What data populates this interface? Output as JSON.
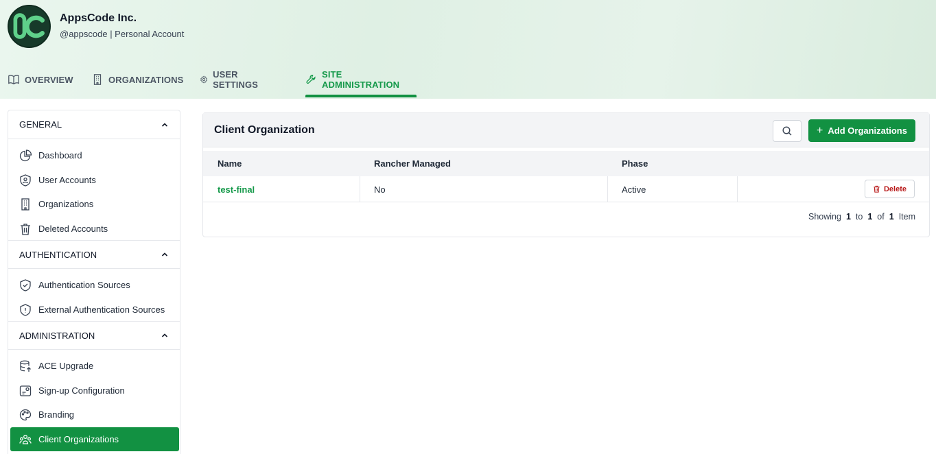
{
  "header": {
    "org_name": "AppsCode Inc.",
    "org_sub": "@appscode | Personal Account"
  },
  "tabs": [
    {
      "label": "OVERVIEW",
      "icon": "book-icon"
    },
    {
      "label": "ORGANIZATIONS",
      "icon": "building-icon"
    },
    {
      "label": "USER SETTINGS",
      "icon": "gear-icon"
    },
    {
      "label": "SITE ADMINISTRATION",
      "icon": "wrench-icon",
      "active": true
    }
  ],
  "sidebar": {
    "sections": [
      {
        "title": "GENERAL",
        "items": [
          {
            "label": "Dashboard",
            "icon": "pie-chart-icon"
          },
          {
            "label": "User Accounts",
            "icon": "user-shield-icon"
          },
          {
            "label": "Organizations",
            "icon": "building-icon"
          },
          {
            "label": "Deleted Accounts",
            "icon": "trash-icon"
          }
        ]
      },
      {
        "title": "AUTHENTICATION",
        "items": [
          {
            "label": "Authentication Sources",
            "icon": "shield-check-icon"
          },
          {
            "label": "External Authentication Sources",
            "icon": "shield-icon"
          }
        ]
      },
      {
        "title": "ADMINISTRATION",
        "items": [
          {
            "label": "ACE Upgrade",
            "icon": "database-upgrade-icon"
          },
          {
            "label": "Sign-up Configuration",
            "icon": "signup-config-icon"
          },
          {
            "label": "Branding",
            "icon": "palette-icon"
          },
          {
            "label": "Client Organizations",
            "icon": "users-group-icon",
            "active": true
          }
        ]
      }
    ]
  },
  "panel": {
    "title": "Client Organization",
    "add_label": "Add Organizations",
    "columns": [
      "Name",
      "Rancher Managed",
      "Phase"
    ],
    "rows": [
      {
        "name": "test-final",
        "rancher_managed": "No",
        "phase": "Active",
        "action": "Delete"
      }
    ],
    "pagination": {
      "showing": "Showing",
      "from": "1",
      "to_word": "to",
      "to": "1",
      "of_word": "of",
      "total": "1",
      "unit": "Item"
    }
  },
  "colors": {
    "accent": "#129142",
    "danger": "#b91c1c"
  }
}
